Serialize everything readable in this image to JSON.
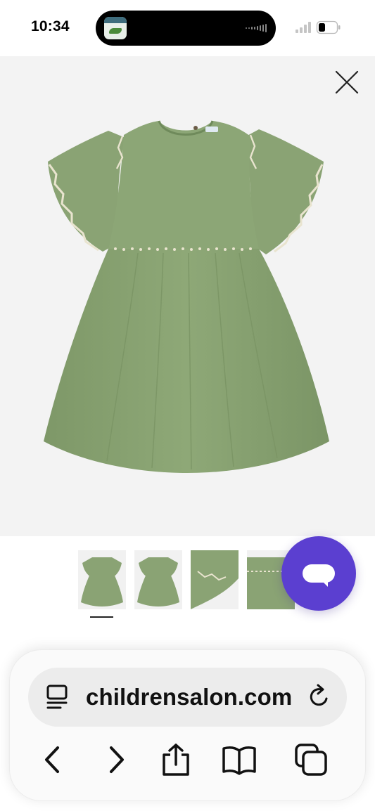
{
  "status_bar": {
    "time": "10:34"
  },
  "viewer": {
    "close_icon": "close-icon",
    "product_image": "green-girls-dress",
    "thumbnails": [
      {
        "name": "front-view",
        "selected": true
      },
      {
        "name": "back-view",
        "selected": false
      },
      {
        "name": "sleeve-detail",
        "selected": false
      },
      {
        "name": "waist-detail",
        "selected": false
      }
    ]
  },
  "chat": {
    "icon": "chat-bubble-icon",
    "color": "#5b3fd0"
  },
  "browser": {
    "url": "childrensalon.com",
    "reader_icon": "page-menu-icon",
    "reload_icon": "reload-icon",
    "toolbar": [
      "back-icon",
      "forward-icon",
      "share-icon",
      "bookmarks-icon",
      "tabs-icon"
    ]
  },
  "colors": {
    "dress_green": "#8aa374",
    "background": "#f3f3f3"
  }
}
